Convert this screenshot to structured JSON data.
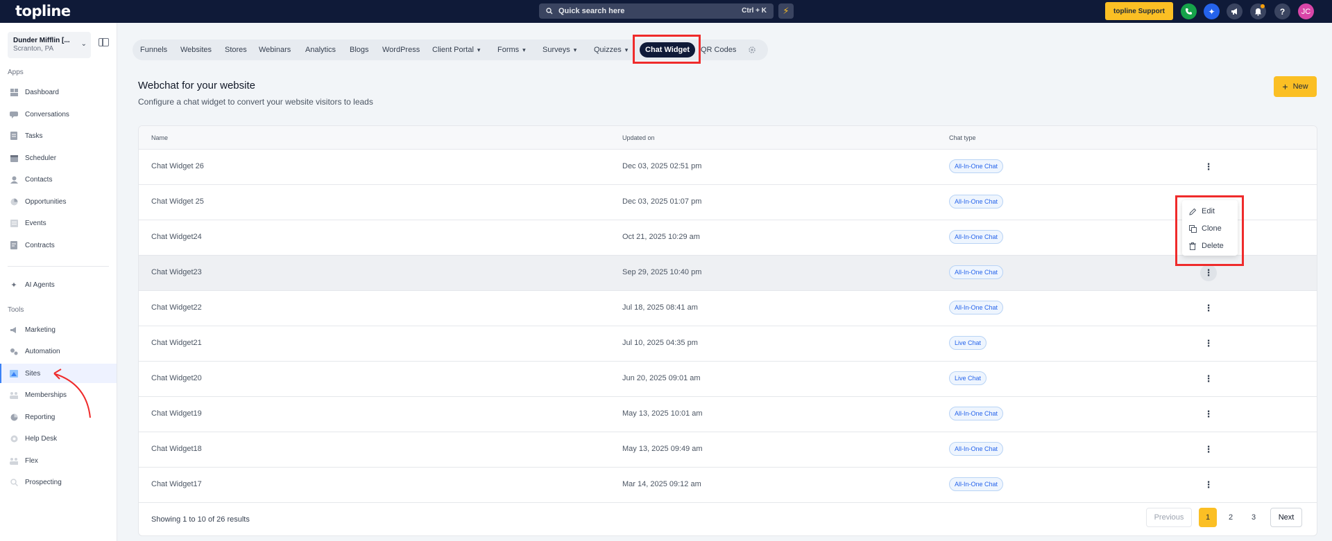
{
  "topbar": {
    "logo": "topline",
    "search_placeholder": "Quick search here",
    "search_shortcut": "Ctrl + K",
    "support_label": "topline Support",
    "avatar_initials": "JC"
  },
  "sidebar": {
    "account_name": "Dunder Mifflin [...",
    "account_location": "Scranton, PA",
    "apps_label": "Apps",
    "tools_label": "Tools",
    "apps": [
      {
        "label": "Dashboard",
        "icon": "dashboard-icon"
      },
      {
        "label": "Conversations",
        "icon": "chat-icon"
      },
      {
        "label": "Tasks",
        "icon": "tasks-icon"
      },
      {
        "label": "Scheduler",
        "icon": "calendar-icon"
      },
      {
        "label": "Contacts",
        "icon": "contacts-icon"
      },
      {
        "label": "Opportunities",
        "icon": "opportunities-icon"
      },
      {
        "label": "Events",
        "icon": "events-icon"
      },
      {
        "label": "Contracts",
        "icon": "contracts-icon"
      }
    ],
    "ai_agents": "AI Agents",
    "tools": [
      {
        "label": "Marketing",
        "icon": "megaphone-icon"
      },
      {
        "label": "Automation",
        "icon": "automation-icon"
      },
      {
        "label": "Sites",
        "icon": "sites-icon"
      },
      {
        "label": "Memberships",
        "icon": "memberships-icon"
      },
      {
        "label": "Reporting",
        "icon": "reporting-icon"
      },
      {
        "label": "Help Desk",
        "icon": "helpdesk-icon"
      },
      {
        "label": "Flex",
        "icon": "flex-icon"
      },
      {
        "label": "Prospecting",
        "icon": "prospecting-icon"
      }
    ],
    "active_item": "Sites"
  },
  "tabs": [
    {
      "label": "Funnels"
    },
    {
      "label": "Websites"
    },
    {
      "label": "Stores"
    },
    {
      "label": "Webinars"
    },
    {
      "label": "Analytics"
    },
    {
      "label": "Blogs"
    },
    {
      "label": "WordPress"
    },
    {
      "label": "Client Portal",
      "dropdown": true
    },
    {
      "label": "Forms",
      "dropdown": true
    },
    {
      "label": "Surveys",
      "dropdown": true
    },
    {
      "label": "Quizzes",
      "dropdown": true
    },
    {
      "label": "Chat Widget",
      "active": true
    },
    {
      "label": "QR Codes"
    }
  ],
  "header": {
    "title": "Webchat for your website",
    "subtitle": "Configure a chat widget to convert your website visitors to leads",
    "new_label": "New"
  },
  "table": {
    "columns": [
      "Name",
      "Updated on",
      "Chat type"
    ],
    "rows": [
      {
        "name": "Chat Widget 26",
        "updated": "Dec 03, 2025 02:51 pm",
        "type": "All-In-One Chat"
      },
      {
        "name": "Chat Widget 25",
        "updated": "Dec 03, 2025 01:07 pm",
        "type": "All-In-One Chat"
      },
      {
        "name": "Chat Widget24",
        "updated": "Oct 21, 2025 10:29 am",
        "type": "All-In-One Chat"
      },
      {
        "name": "Chat Widget23",
        "updated": "Sep 29, 2025 10:40 pm",
        "type": "All-In-One Chat"
      },
      {
        "name": "Chat Widget22",
        "updated": "Jul 18, 2025 08:41 am",
        "type": "All-In-One Chat"
      },
      {
        "name": "Chat Widget21",
        "updated": "Jul 10, 2025 04:35 pm",
        "type": "Live Chat"
      },
      {
        "name": "Chat Widget20",
        "updated": "Jun 20, 2025 09:01 am",
        "type": "Live Chat"
      },
      {
        "name": "Chat Widget19",
        "updated": "May 13, 2025 10:01 am",
        "type": "All-In-One Chat"
      },
      {
        "name": "Chat Widget18",
        "updated": "May 13, 2025 09:49 am",
        "type": "All-In-One Chat"
      },
      {
        "name": "Chat Widget17",
        "updated": "Mar 14, 2025 09:12 am",
        "type": "All-In-One Chat"
      }
    ],
    "results_text": "Showing 1 to 10 of 26 results",
    "prev_label": "Previous",
    "next_label": "Next",
    "pages": [
      "1",
      "2",
      "3"
    ],
    "current_page": "1"
  },
  "row_menu": {
    "items": [
      {
        "label": "Edit",
        "icon": "pencil-icon"
      },
      {
        "label": "Clone",
        "icon": "copy-icon"
      },
      {
        "label": "Delete",
        "icon": "trash-icon"
      }
    ]
  },
  "colors": {
    "topbar": "#0f1a38",
    "accent": "#fbbf24",
    "highlight": "#ef2b2b",
    "badge_text": "#2563eb"
  }
}
